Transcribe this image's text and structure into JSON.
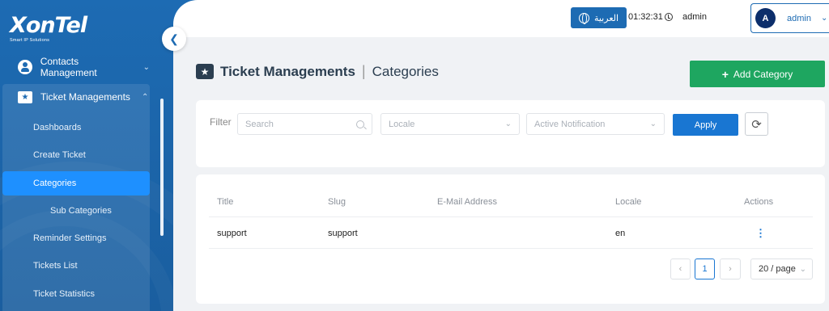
{
  "brand": {
    "logo": "XonTel",
    "tagline": "Smart IP Solutions"
  },
  "sidebar": {
    "contacts": "Contacts Management",
    "ticket_group": "Ticket Managements",
    "items": [
      {
        "label": "Dashboards"
      },
      {
        "label": "Create Ticket"
      },
      {
        "label": "Categories"
      },
      {
        "label": "Sub Categories"
      },
      {
        "label": "Reminder Settings"
      },
      {
        "label": "Tickets List"
      },
      {
        "label": "Ticket Statistics"
      }
    ]
  },
  "header": {
    "language": "العربية",
    "time": "01:32:31",
    "admin_label": "admin",
    "user": {
      "initial": "A",
      "name": "admin"
    }
  },
  "page": {
    "title": "Ticket Managements",
    "subtitle": "Categories",
    "add_button": "Add Category"
  },
  "filter": {
    "label": "Filter",
    "search_placeholder": "Search",
    "locale_placeholder": "Locale",
    "notification_placeholder": "Active Notification",
    "apply": "Apply"
  },
  "table": {
    "columns": [
      "Title",
      "Slug",
      "E-Mail Address",
      "Locale",
      "Actions"
    ],
    "rows": [
      {
        "title": "support",
        "slug": "support",
        "email": "",
        "locale": "en"
      }
    ]
  },
  "pagination": {
    "current": "1",
    "page_size": "20 / page"
  },
  "colors": {
    "sidebar": "#1d6bb3",
    "primary": "#1976d2",
    "success": "#1ea660",
    "active_item": "#1e90ff"
  }
}
